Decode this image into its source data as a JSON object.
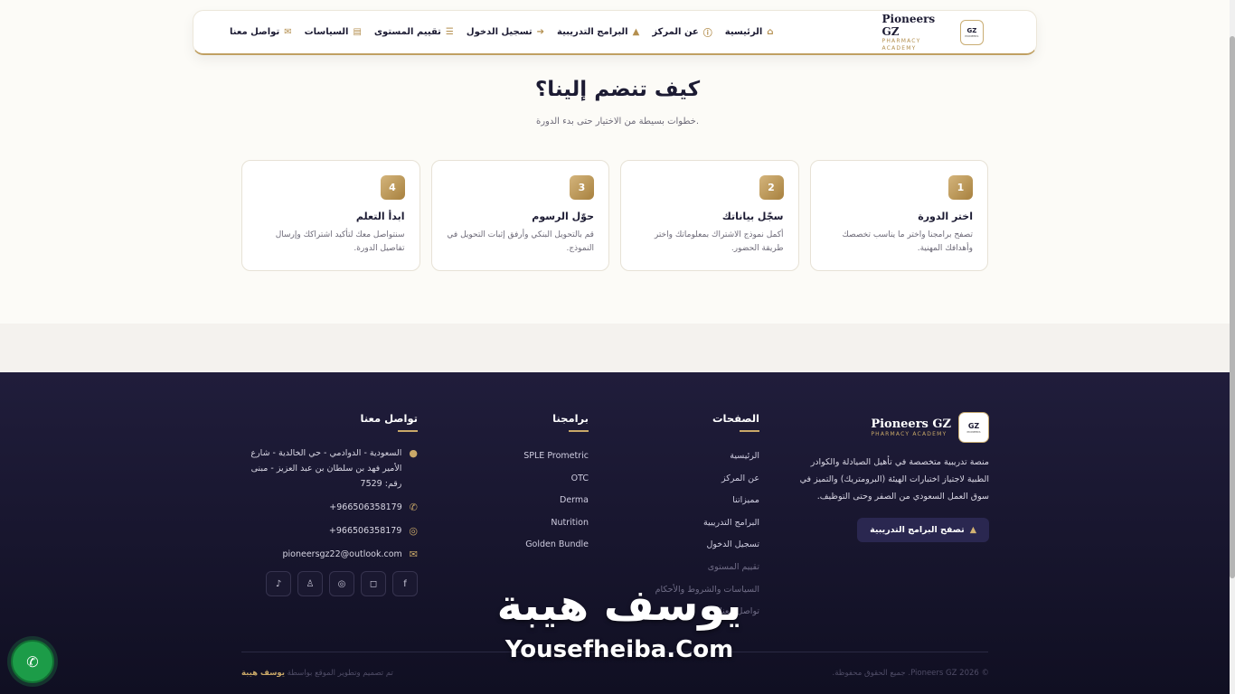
{
  "nav": {
    "brand_name": "Pioneers GZ",
    "brand_sub": "PHARMACY ACADEMY",
    "logo_text": "GZ",
    "logo_sub": "PIONEERS",
    "items": [
      {
        "label": "الرئيسية",
        "icon": "home-icon"
      },
      {
        "label": "عن المركز",
        "icon": "info-icon"
      },
      {
        "label": "البرامج التدريبية",
        "icon": "graduation-cap-icon"
      },
      {
        "label": "تسجيل الدخول",
        "icon": "sign-in-icon"
      },
      {
        "label": "تقييم المستوى",
        "icon": "list-icon"
      },
      {
        "label": "السياسات",
        "icon": "document-icon"
      },
      {
        "label": "تواصل معنا",
        "icon": "envelope-icon"
      }
    ]
  },
  "section": {
    "title": "كيف تنضم إلينا؟",
    "subtitle": "خطوات بسيطة من الاختيار حتى بدء الدورة."
  },
  "steps": [
    {
      "num": "1",
      "title": "اختر الدورة",
      "desc": "تصفح برامجنا واختر ما يناسب تخصصك وأهدافك المهنية."
    },
    {
      "num": "2",
      "title": "سجّل بياناتك",
      "desc": "أكمل نموذج الاشتراك بمعلوماتك واختر طريقة الحضور."
    },
    {
      "num": "3",
      "title": "حوّل الرسوم",
      "desc": "قم بالتحويل البنكي وأرفق إثبات التحويل في النموذج."
    },
    {
      "num": "4",
      "title": "ابدأ التعلم",
      "desc": "سنتواصل معك لتأكيد اشتراكك وإرسال تفاصيل الدورة."
    }
  ],
  "footer": {
    "brand_name": "Pioneers GZ",
    "brand_sub": "PHARMACY ACADEMY",
    "logo_text": "GZ",
    "logo_sub": "PIONEERS",
    "description": "منصة تدريبية متخصصة في تأهيل الصيادلة والكوادر الطبية لاجتياز اختبارات الهيئة (البرومتريك) والتميز في سوق العمل السعودي من الصفر وحتى التوظيف.",
    "cta_label": "تصفح البرامج التدريبية",
    "pages_title": "الصفحات",
    "pages": [
      "الرئيسية",
      "عن المركز",
      "مميزاتنا",
      "البرامج التدريبية",
      "تسجيل الدخول",
      "تقييم المستوى",
      "السياسات والشروط والأحكام",
      "تواصل معنا"
    ],
    "programs_title": "برامجنا",
    "programs": [
      "SPLE Prometric",
      "OTC",
      "Derma",
      "Nutrition",
      "Golden Bundle"
    ],
    "contact_title": "تواصل معنا",
    "address": "السعودية - الدوادمي - حي الخالدية - شارع الأمير فهد بن سلطان بن عبد العزيز - مبنى رقم: 7529",
    "phone": "+966506358179",
    "whatsapp": "+966506358179",
    "email": "pioneersgz22@outlook.com",
    "socials": [
      "facebook-icon",
      "instagram-icon",
      "whatsapp-icon",
      "snapchat-icon",
      "tiktok-icon"
    ],
    "copyright": "© 2026 Pioneers GZ. جميع الحقوق محفوظة.",
    "credit_prefix": "تم تصميم وتطوير الموقع بواسطة",
    "credit_name": "يوسف هيبة"
  },
  "watermark": {
    "arabic": "يوسف هيبة",
    "english": "Yousefheiba.Com"
  },
  "colors": {
    "navy": "#1c1b33",
    "gold": "#c9a868",
    "footer_bg": "#201d3b",
    "whatsapp_green": "#1c9c48"
  }
}
